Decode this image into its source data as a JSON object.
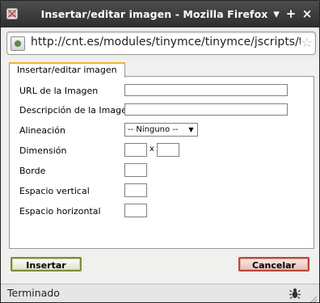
{
  "window": {
    "title": "Insertar/editar imagen - Mozilla Firefox",
    "minimize_glyph": "▾",
    "maximize_glyph": "+",
    "close_glyph": "×"
  },
  "urlbar": {
    "url": "http://cnt.es/modules/tinymce/tinymce/jscripts/tiny_mce/",
    "bookmark_glyph": "☆"
  },
  "dialog": {
    "tab_label": "Insertar/editar imagen",
    "fields": {
      "image_url": {
        "label": "URL de la Imagen",
        "value": ""
      },
      "image_description": {
        "label": "Descripción de la Imagen",
        "value": ""
      },
      "alignment": {
        "label": "Alineación",
        "selected": "-- Ninguno --"
      },
      "dimension": {
        "label": "Dimensión",
        "width": "",
        "height": "",
        "separator": "x"
      },
      "border": {
        "label": "Borde",
        "value": ""
      },
      "vspace": {
        "label": "Espacio vertical",
        "value": ""
      },
      "hspace": {
        "label": "Espacio horizontal",
        "value": ""
      }
    },
    "insert_label": "Insertar",
    "cancel_label": "Cancelar"
  },
  "status": {
    "text": "Terminado"
  },
  "colors": {
    "titlebar": "#3c3c3c",
    "tab_accent": "#f0b52f",
    "insert_border": "#7a8f3a",
    "cancel_border": "#b64a3a"
  }
}
